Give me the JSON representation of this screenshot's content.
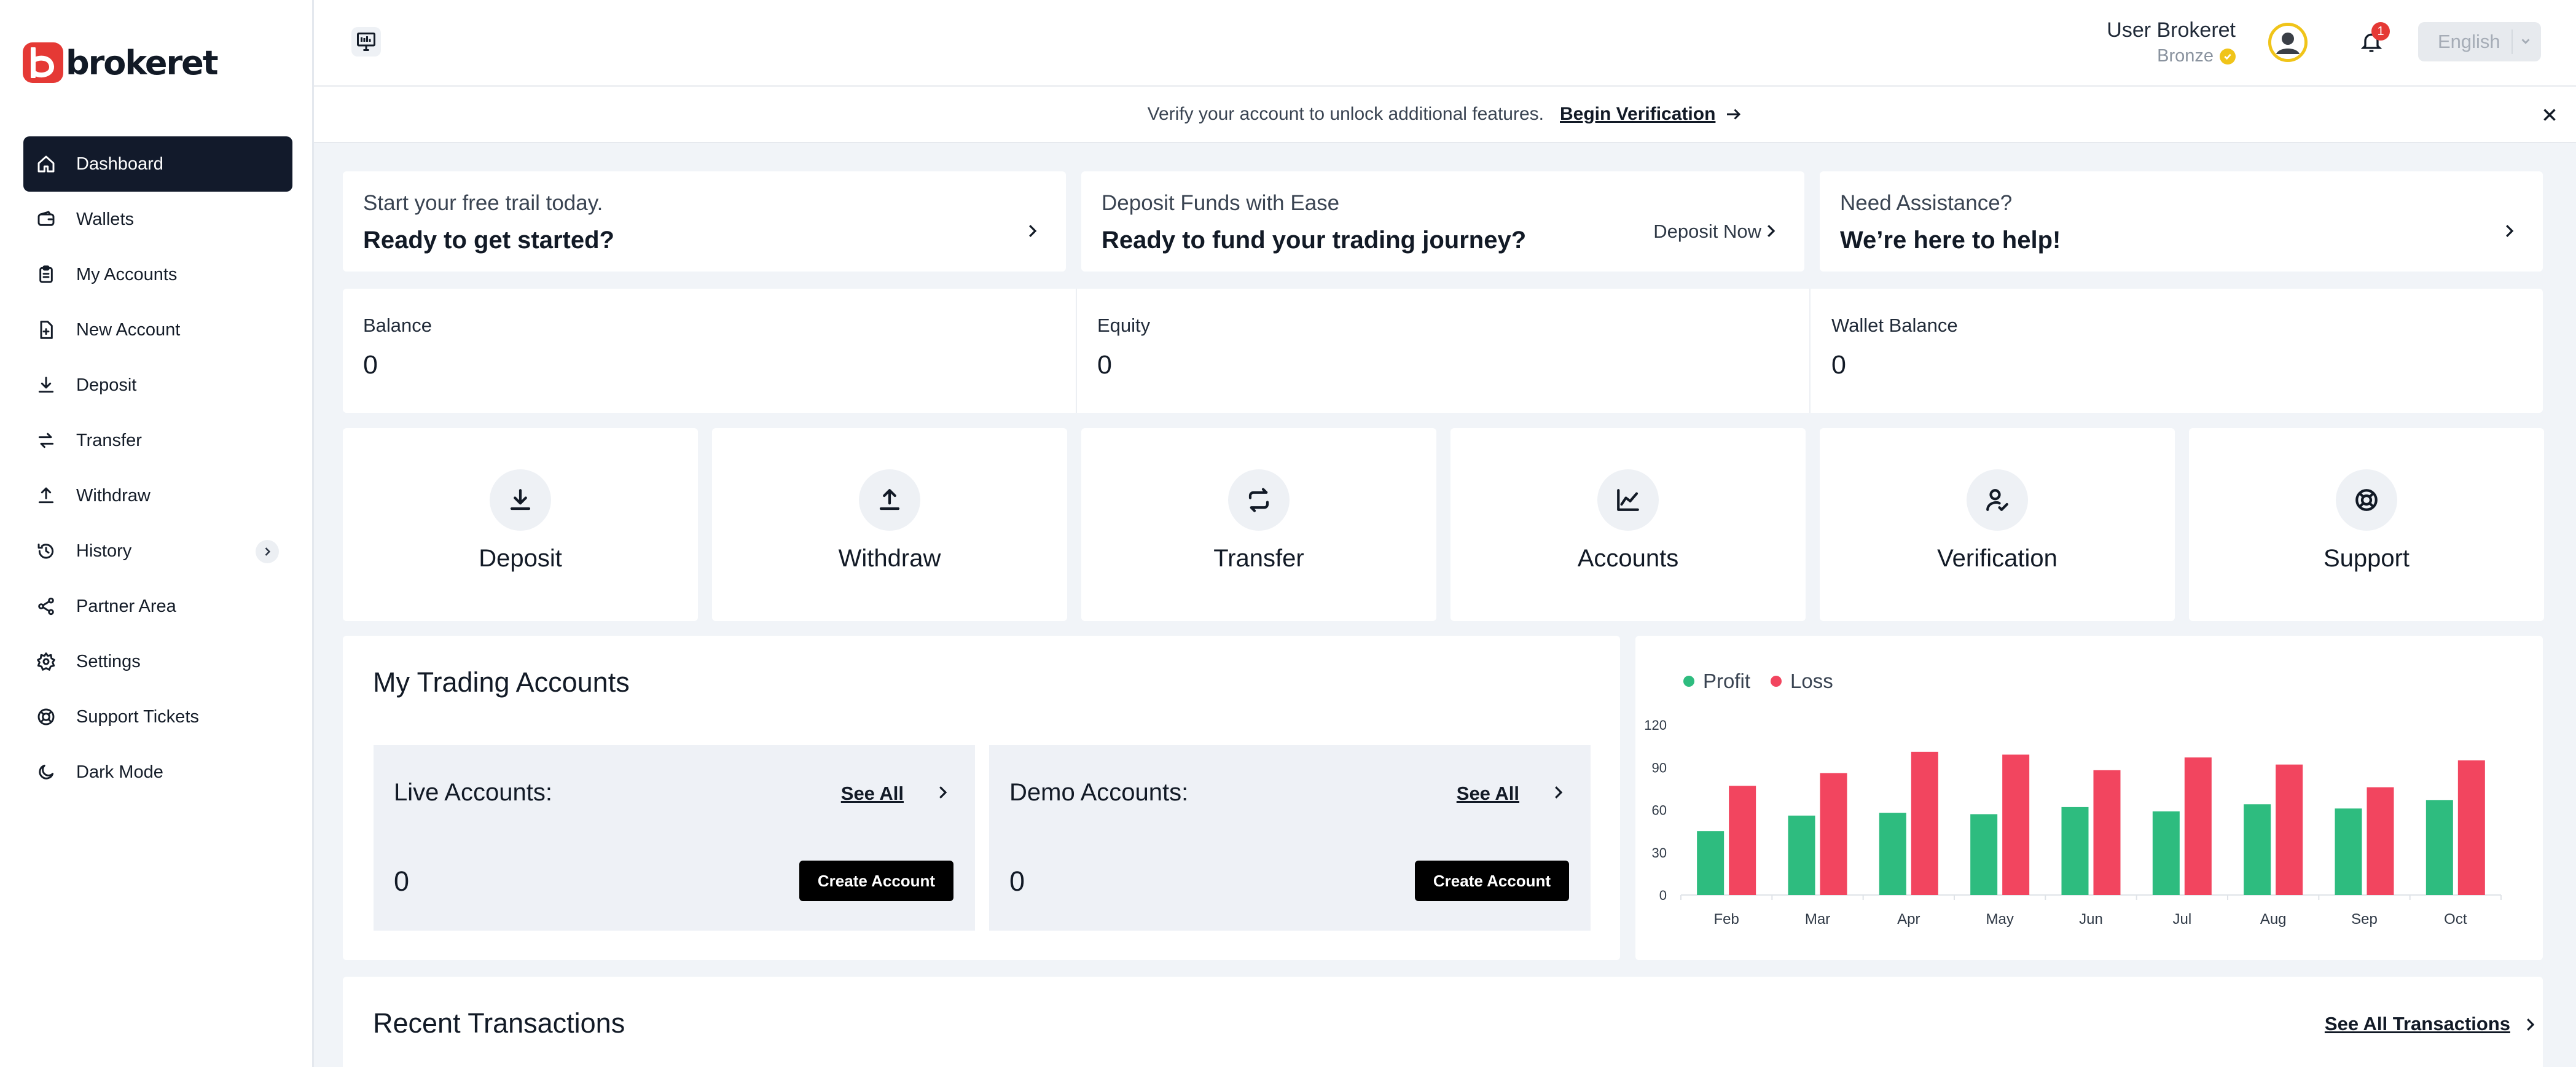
{
  "brand": {
    "name": "brokeret",
    "logo_letter": "b",
    "accent": "#e53935"
  },
  "sidebar": {
    "items": [
      {
        "label": "Dashboard",
        "icon": "home-icon",
        "active": true
      },
      {
        "label": "Wallets",
        "icon": "wallet-icon"
      },
      {
        "label": "My Accounts",
        "icon": "clipboard-icon"
      },
      {
        "label": "New Account",
        "icon": "file-plus-icon"
      },
      {
        "label": "Deposit",
        "icon": "download-icon"
      },
      {
        "label": "Transfer",
        "icon": "transfer-icon"
      },
      {
        "label": "Withdraw",
        "icon": "upload-icon"
      },
      {
        "label": "History",
        "icon": "history-icon",
        "expandable": true
      },
      {
        "label": "Partner Area",
        "icon": "share-icon"
      },
      {
        "label": "Settings",
        "icon": "gear-icon"
      },
      {
        "label": "Support Tickets",
        "icon": "lifebuoy-icon"
      },
      {
        "label": "Dark Mode",
        "icon": "moon-icon"
      }
    ]
  },
  "topbar": {
    "user_name": "User Brokeret",
    "user_tier": "Bronze",
    "notification_count": "1",
    "language": "English"
  },
  "banner": {
    "text": "Verify your account to unlock additional features.",
    "link": "Begin Verification"
  },
  "promos": [
    {
      "top": "Start your free trail today.",
      "bottom": "Ready to get started?"
    },
    {
      "top": "Deposit Funds with Ease",
      "bottom": "Ready to fund your trading journey?",
      "action": "Deposit Now"
    },
    {
      "top": "Need Assistance?",
      "bottom": "We’re here to help!"
    }
  ],
  "stats": [
    {
      "label": "Balance",
      "value": "0"
    },
    {
      "label": "Equity",
      "value": "0"
    },
    {
      "label": "Wallet Balance",
      "value": "0"
    }
  ],
  "actions": [
    {
      "label": "Deposit",
      "icon": "download-icon"
    },
    {
      "label": "Withdraw",
      "icon": "upload-icon"
    },
    {
      "label": "Transfer",
      "icon": "transfer-icon"
    },
    {
      "label": "Accounts",
      "icon": "chart-line-icon"
    },
    {
      "label": "Verification",
      "icon": "user-check-icon"
    },
    {
      "label": "Support",
      "icon": "lifebuoy-icon"
    }
  ],
  "trading": {
    "title": "My Trading Accounts",
    "live": {
      "title": "Live Accounts:",
      "see_all": "See All",
      "count": "0",
      "button": "Create Account"
    },
    "demo": {
      "title": "Demo Accounts:",
      "see_all": "See All",
      "count": "0",
      "button": "Create Account"
    }
  },
  "recent": {
    "title": "Recent Transactions",
    "see_all": "See All Transactions"
  },
  "chart_data": {
    "type": "bar",
    "categories": [
      "Feb",
      "Mar",
      "Apr",
      "May",
      "Jun",
      "Jul",
      "Aug",
      "Sep",
      "Oct"
    ],
    "series": [
      {
        "name": "Profit",
        "color": "#2ebc7f",
        "values": [
          45,
          56,
          58,
          57,
          62,
          59,
          64,
          61,
          67
        ]
      },
      {
        "name": "Loss",
        "color": "#f2455f",
        "values": [
          77,
          86,
          101,
          99,
          88,
          97,
          92,
          76,
          95
        ]
      }
    ],
    "yticks": [
      "0",
      "30",
      "60",
      "90",
      "120"
    ],
    "ylim": [
      0,
      120
    ],
    "legend": "top-left",
    "grid": false
  }
}
